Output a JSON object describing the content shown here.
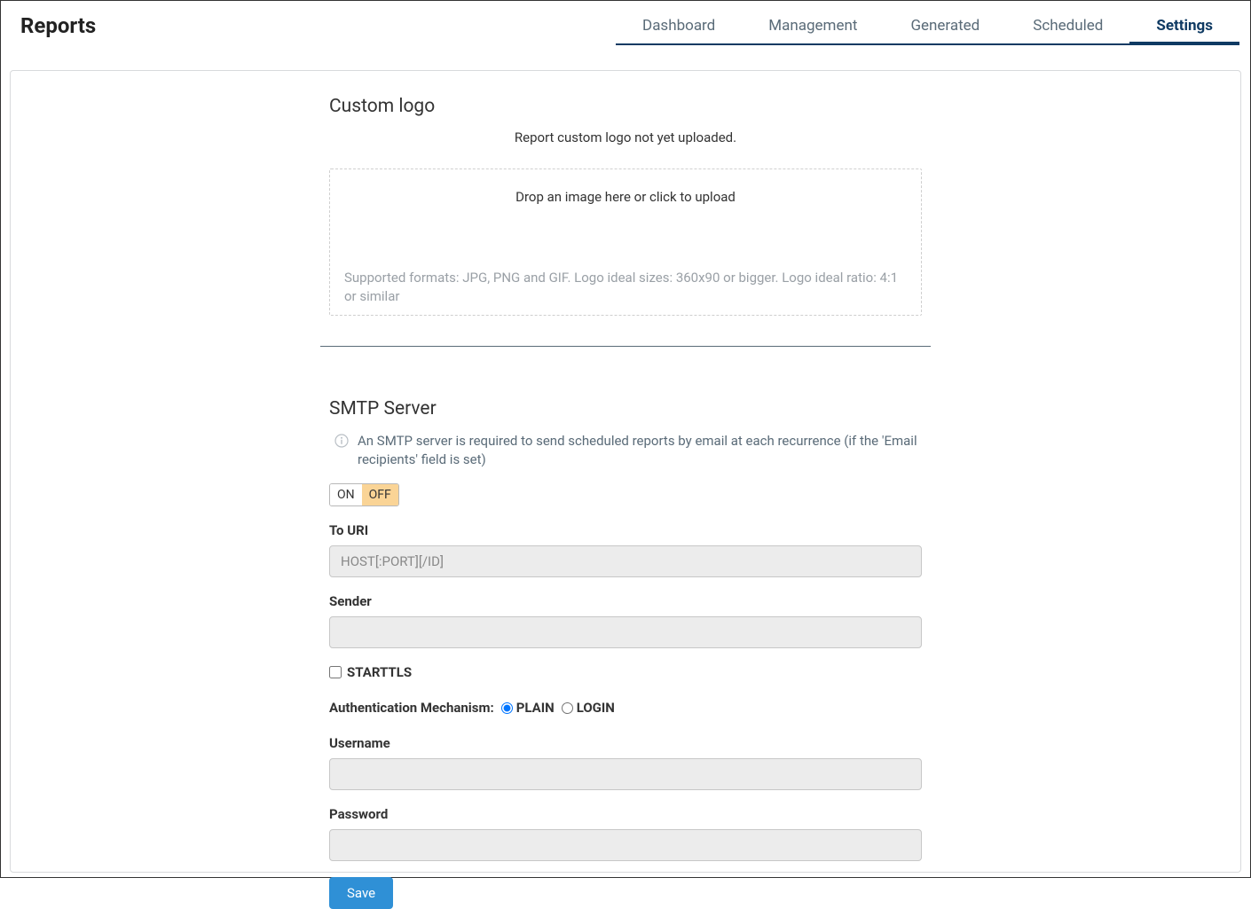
{
  "header": {
    "title": "Reports",
    "tabs": [
      {
        "label": "Dashboard"
      },
      {
        "label": "Management"
      },
      {
        "label": "Generated"
      },
      {
        "label": "Scheduled"
      },
      {
        "label": "Settings"
      }
    ]
  },
  "logo_section": {
    "title": "Custom logo",
    "status": "Report custom logo not yet uploaded.",
    "drop_text": "Drop an image here or click to upload",
    "hint": "Supported formats: JPG, PNG and GIF. Logo ideal sizes: 360x90 or bigger. Logo ideal ratio: 4:1 or similar"
  },
  "smtp": {
    "title": "SMTP Server",
    "info": "An SMTP server is required to send scheduled reports by email at each recurrence (if the 'Email recipients' field is set)",
    "toggle_on": "ON",
    "toggle_off": "OFF",
    "to_uri_label": "To URI",
    "to_uri_placeholder": "HOST[:PORT][/ID]",
    "sender_label": "Sender",
    "starttls_label": "STARTTLS",
    "auth_label": "Authentication Mechanism:",
    "auth_plain": "PLAIN",
    "auth_login": "LOGIN",
    "username_label": "Username",
    "password_label": "Password",
    "save_label": "Save"
  }
}
